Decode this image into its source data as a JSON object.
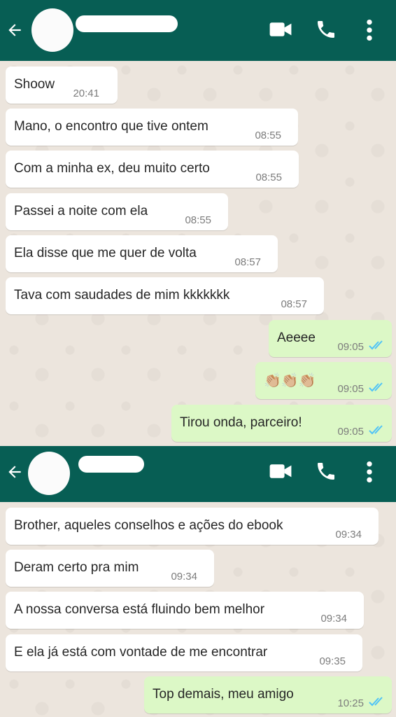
{
  "chat1": {
    "messages": [
      {
        "text": "Shoow",
        "time": "20:41"
      },
      {
        "text": "Mano, o encontro que tive ontem",
        "time": "08:55"
      },
      {
        "text": "Com a minha ex, deu muito certo",
        "time": "08:55"
      },
      {
        "text": "Passei a noite com ela",
        "time": "08:55"
      },
      {
        "text": "Ela disse que me quer de volta",
        "time": "08:57"
      },
      {
        "text": "Tava com saudades de mim kkkkkkk",
        "time": "08:57"
      },
      {
        "text": "Aeeee",
        "time": "09:05"
      },
      {
        "text": "👏🏼👏🏼👏🏼",
        "time": "09:05"
      },
      {
        "text": "Tirou onda, parceiro!",
        "time": "09:05"
      }
    ]
  },
  "chat2": {
    "messages": [
      {
        "text": "Brother, aqueles conselhos e ações do ebook",
        "time": "09:34"
      },
      {
        "text": "Deram certo pra mim",
        "time": "09:34"
      },
      {
        "text": "A nossa conversa está fluindo bem melhor",
        "time": "09:34"
      },
      {
        "text": "E ela já está com vontade de me encontrar",
        "time": "09:35"
      },
      {
        "text": "Top demais, meu amigo",
        "time": "10:25"
      }
    ]
  },
  "icons": {
    "back": "arrow-back-icon",
    "video": "video-camera-icon",
    "call": "phone-icon",
    "menu": "more-vert-icon",
    "read": "double-check-icon"
  },
  "colors": {
    "appbar": "#075e54",
    "outgoing_bubble": "#dcf8c6",
    "incoming_bubble": "#ffffff",
    "read_ticks": "#4fc3f7",
    "chat_background": "#ece5dd"
  }
}
